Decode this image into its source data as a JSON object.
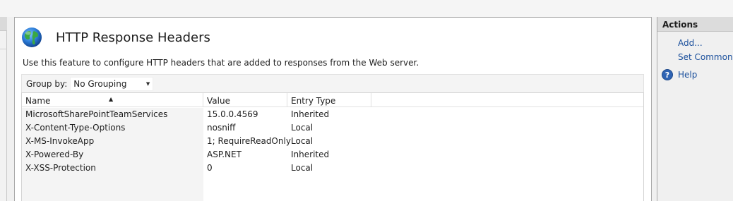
{
  "page": {
    "title": "HTTP Response Headers",
    "description": "Use this feature to configure HTTP headers that are added to responses from the Web server."
  },
  "toolbar": {
    "group_by_label": "Group by:",
    "group_by_value": "No Grouping"
  },
  "table": {
    "columns": [
      "Name",
      "Value",
      "Entry Type"
    ],
    "rows": [
      {
        "name": "MicrosoftSharePointTeamServices",
        "value": "15.0.0.4569",
        "entry_type": "Inherited"
      },
      {
        "name": "X-Content-Type-Options",
        "value": "nosniff",
        "entry_type": "Local"
      },
      {
        "name": "X-MS-InvokeApp",
        "value": "1; RequireReadOnly",
        "entry_type": "Local"
      },
      {
        "name": "X-Powered-By",
        "value": "ASP.NET",
        "entry_type": "Inherited"
      },
      {
        "name": "X-XSS-Protection",
        "value": "0",
        "entry_type": "Local"
      }
    ]
  },
  "actions": {
    "header": "Actions",
    "items": [
      "Add...",
      "Set Common H"
    ],
    "help": "Help"
  },
  "icons": {
    "feature_icon": "globe-icon",
    "sort_indicator": "sort-ascending-icon",
    "dropdown": "chevron-down-icon",
    "help": "help-icon"
  },
  "colors": {
    "link": "#1a4f9c",
    "actions_header_bg": "#dcdcdc",
    "panel_bg": "#ffffff"
  }
}
